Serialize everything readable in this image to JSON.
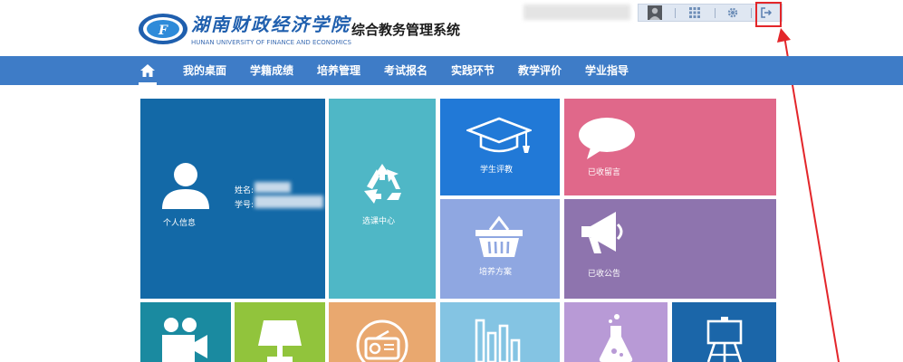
{
  "header": {
    "school_name_cn": "湖南财政经济学院",
    "school_name_en": "HUNAN UNIVERSITY OF FINANCE AND ECONOMICS",
    "system_title": "综合教务管理系统",
    "toolbar": [
      {
        "name": "user-avatar",
        "icon": "avatar-icon"
      },
      {
        "name": "apps",
        "icon": "grid-icon"
      },
      {
        "name": "settings",
        "icon": "gear-icon"
      },
      {
        "name": "logout",
        "icon": "logout-icon"
      }
    ]
  },
  "nav": {
    "home_icon": "home-icon",
    "items": [
      "我的桌面",
      "学籍成绩",
      "培养管理",
      "考试报名",
      "实践环节",
      "教学评价",
      "学业指导"
    ]
  },
  "tiles": {
    "profile": {
      "label": "个人信息",
      "name_label": "姓名:",
      "id_label": "学号:",
      "color": "#1369a7"
    },
    "course_selection": {
      "label": "选课中心",
      "color": "#4fb7c6"
    },
    "evaluation": {
      "label": "学生评教",
      "color": "#2179d7"
    },
    "messages": {
      "label": "已收留言",
      "color": "#e0688a"
    },
    "training_plan": {
      "label": "培养方案",
      "color": "#8fa7e1"
    },
    "announcements": {
      "label": "已收公告",
      "color": "#8e74ae"
    },
    "row3": [
      {
        "icon": "video-camera-icon",
        "color": "#1a8aa0"
      },
      {
        "icon": "lamp-icon",
        "color": "#91c43c"
      },
      {
        "icon": "radio-icon",
        "color": "#e9a86f"
      },
      {
        "icon": "bar-chart-icon",
        "color": "#84c4e3"
      },
      {
        "icon": "flask-icon",
        "color": "#b89ad6"
      },
      {
        "icon": "easel-icon",
        "color": "#1b66a9"
      }
    ]
  },
  "colors": {
    "nav_bar": "#3e7cc7",
    "highlight": "#e3262a",
    "brand_blue": "#1f5fae"
  }
}
